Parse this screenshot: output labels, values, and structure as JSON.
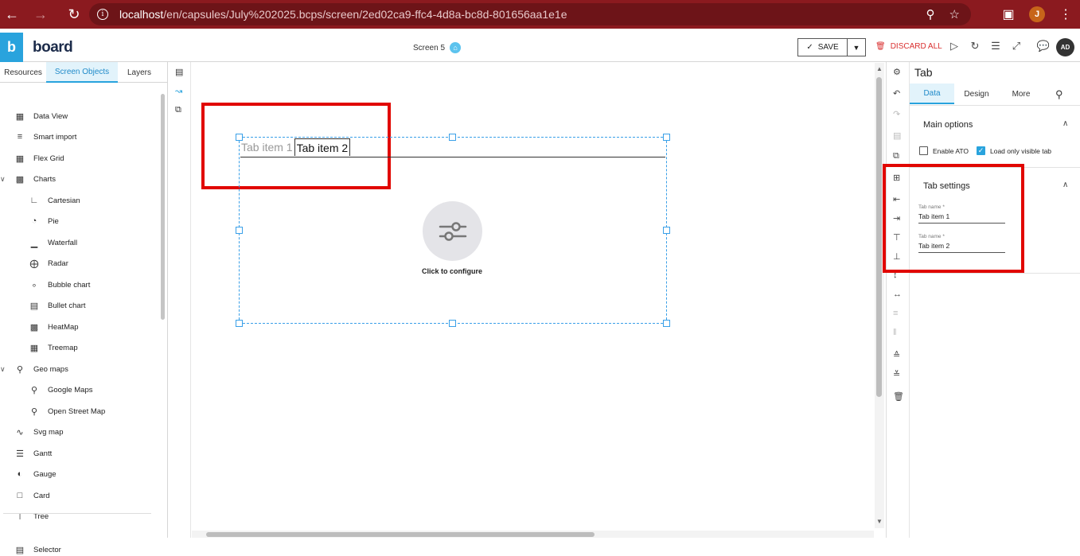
{
  "browser": {
    "url_host": "localhost",
    "url_path": "/en/capsules/July%202025.bcps/screen/2ed02ca9-ffc4-4d8a-bc8d-801656aa1e1e",
    "profile_initial": "J"
  },
  "header": {
    "logo_letter": "b",
    "logo_text": "board",
    "screen_title": "Screen 5",
    "save_label": "SAVE",
    "discard_label": "DISCARD ALL",
    "user_initials": "AD"
  },
  "left_panel": {
    "tabs": [
      "Resources",
      "Screen Objects",
      "Layers"
    ],
    "active_tab": "Screen Objects",
    "items": [
      {
        "label": "Data View",
        "icon": "table-icon"
      },
      {
        "label": "Smart import",
        "icon": "import-icon"
      },
      {
        "label": "Flex Grid",
        "icon": "grid-icon"
      },
      {
        "label": "Charts",
        "icon": "bar-chart-icon"
      },
      {
        "label": "Cartesian",
        "icon": "line-chart-icon"
      },
      {
        "label": "Pie",
        "icon": "pie-chart-icon"
      },
      {
        "label": "Waterfall",
        "icon": "waterfall-icon"
      },
      {
        "label": "Radar",
        "icon": "radar-icon"
      },
      {
        "label": "Bubble chart",
        "icon": "bubble-chart-icon"
      },
      {
        "label": "Bullet chart",
        "icon": "bullet-chart-icon"
      },
      {
        "label": "HeatMap",
        "icon": "heatmap-icon"
      },
      {
        "label": "Treemap",
        "icon": "treemap-icon"
      },
      {
        "label": "Geo maps",
        "icon": "map-pin-icon"
      },
      {
        "label": "Google Maps",
        "icon": "location-icon"
      },
      {
        "label": "Open Street Map",
        "icon": "map-pin-icon"
      },
      {
        "label": "Svg map",
        "icon": "svg-map-icon"
      },
      {
        "label": "Gantt",
        "icon": "gantt-icon"
      },
      {
        "label": "Gauge",
        "icon": "gauge-icon"
      },
      {
        "label": "Card",
        "icon": "card-icon"
      },
      {
        "label": "Tree",
        "icon": "tree-icon"
      },
      {
        "label": "Selector",
        "icon": "selector-icon"
      }
    ]
  },
  "canvas": {
    "tab_items": [
      "Tab item 1",
      "Tab item 2"
    ],
    "configure_label": "Click to configure"
  },
  "properties": {
    "title": "Tab",
    "tabs": [
      "Data",
      "Design",
      "More"
    ],
    "active_tab": "Data",
    "main_options": {
      "title": "Main options",
      "enable_ato_label": "Enable ATO",
      "enable_ato_checked": false,
      "load_visible_label": "Load only visible tab",
      "load_visible_checked": true
    },
    "tab_settings": {
      "title": "Tab settings",
      "fields": [
        {
          "label": "Tab name *",
          "value": "Tab item 1"
        },
        {
          "label": "Tab name *",
          "value": "Tab item 2"
        }
      ]
    }
  },
  "colors": {
    "accent": "#29a3dd",
    "highlight": "#e10600",
    "chrome": "#8b1a1f"
  }
}
